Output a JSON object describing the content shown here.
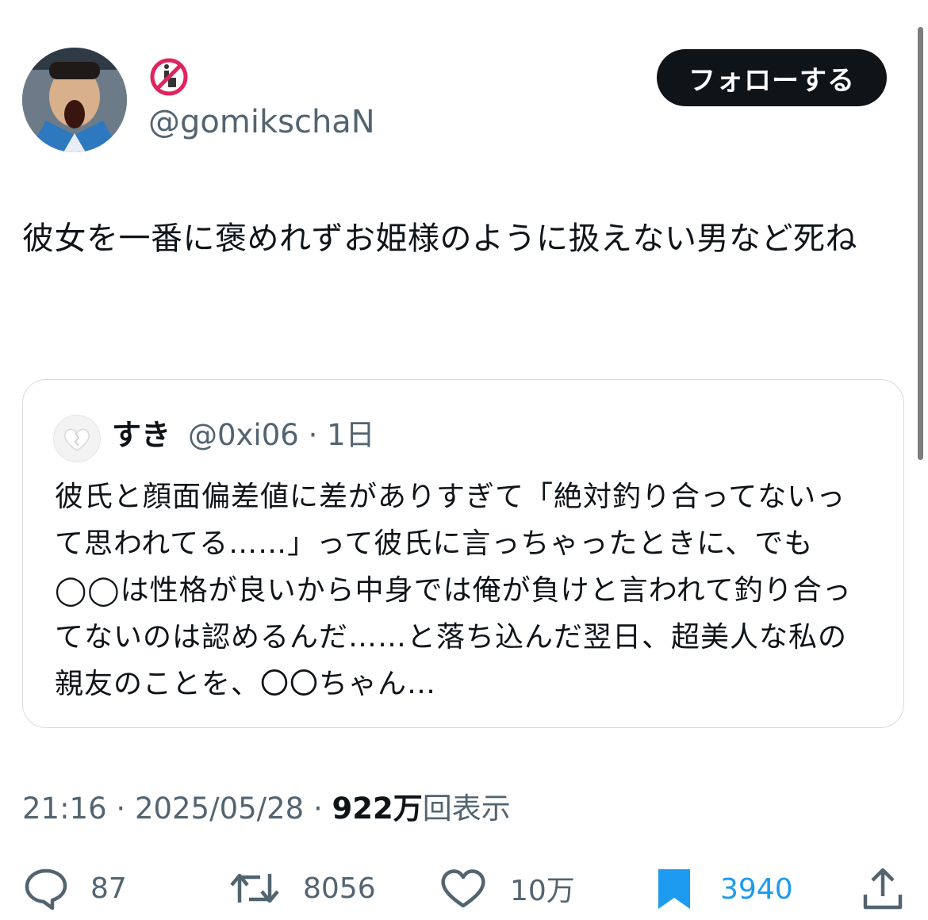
{
  "author": {
    "badge_icon": "no-littering-icon",
    "handle": "@gomikschaN"
  },
  "follow_label": "フォローする",
  "tweet_text": "彼女を一番に褒めれずお姫様のように扱えない男など死ね",
  "quote": {
    "avatar_icon": "heart-icon",
    "name": "すき",
    "handle": "@0xi06",
    "sep": " · ",
    "time": "1日",
    "text": "彼氏と顔面偏差値に差がありすぎて「絶対釣り合ってないって思われてる……」って彼氏に言っちゃったときに、でも◯◯は性格が良いから中身では俺が負けと言われて釣り合ってないのは認めるんだ……と落ち込んだ翌日、超美人な私の親友のことを、〇〇ちゃん…"
  },
  "meta": {
    "time": "21:16",
    "sep1": " · ",
    "date": "2025/05/28",
    "sep2": " · ",
    "views_num": "922万",
    "views_label": "回表示"
  },
  "actions": {
    "reply_count": "87",
    "retweet_count": "8056",
    "like_count": "10万",
    "bookmark_count": "3940"
  },
  "colors": {
    "text": "#0f1419",
    "muted": "#536471",
    "bookmark": "#1d9bf0",
    "follow_bg": "#0f1419"
  }
}
